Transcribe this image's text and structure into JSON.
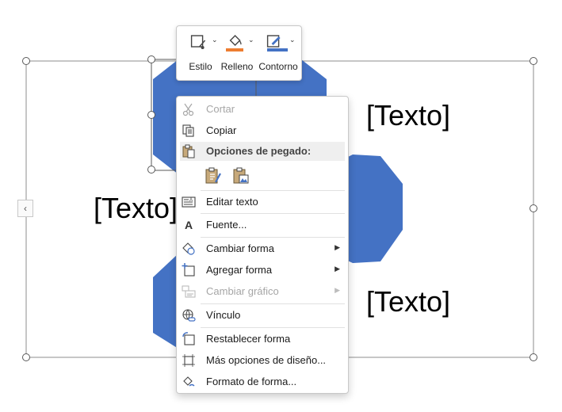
{
  "canvas": {
    "text_placeholders": [
      "[Texto]",
      "[Texto]",
      "[Texto]"
    ],
    "colors": {
      "hexagon": "#4472C4",
      "frame": "#7f7f7f"
    }
  },
  "mini_toolbar": {
    "buttons": [
      {
        "label": "Estilo",
        "icon": "shape-style-icon"
      },
      {
        "label": "Relleno",
        "icon": "fill-bucket-icon",
        "color": "#ED7D31"
      },
      {
        "label": "Contorno",
        "icon": "pen-outline-icon",
        "color": "#4472C4"
      }
    ]
  },
  "context_menu": {
    "items": [
      {
        "label": "Cortar",
        "icon": "scissors-icon",
        "disabled": true
      },
      {
        "label": "Copiar",
        "icon": "copy-icon",
        "disabled": false
      },
      {
        "label": "Opciones de pegado:",
        "icon": "paste-icon",
        "header": true
      },
      {
        "label": "Editar texto",
        "icon": "edit-text-icon",
        "disabled": false
      },
      {
        "label": "Fuente...",
        "icon": "font-icon",
        "disabled": false
      },
      {
        "label": "Cambiar forma",
        "icon": "change-shape-icon",
        "submenu": true
      },
      {
        "label": "Agregar forma",
        "icon": "add-shape-icon",
        "submenu": true
      },
      {
        "label": "Cambiar gráfico",
        "icon": "change-graphic-icon",
        "submenu": true,
        "disabled": true
      },
      {
        "label": "Vínculo",
        "icon": "link-globe-icon",
        "disabled": false
      },
      {
        "label": "Restablecer forma",
        "icon": "reset-shape-icon",
        "disabled": false
      },
      {
        "label": "Más opciones de diseño...",
        "icon": "layout-options-icon",
        "disabled": false
      },
      {
        "label": "Formato de forma...",
        "icon": "format-shape-icon",
        "disabled": false
      }
    ],
    "paste_options": [
      "paste-keep-formatting-icon",
      "paste-picture-icon"
    ]
  }
}
